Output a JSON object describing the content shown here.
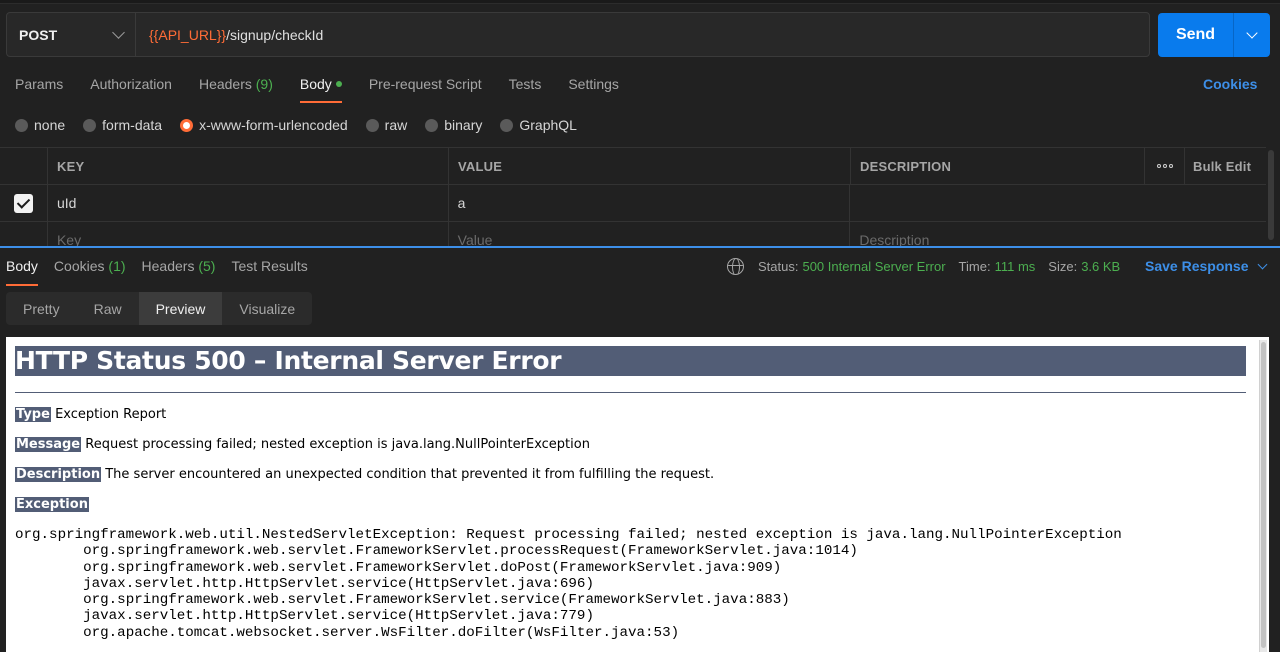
{
  "request": {
    "method": "POST",
    "url_variable": "{{API_URL}}",
    "url_path": "/signup/checkId",
    "send_label": "Send"
  },
  "request_tabs": [
    {
      "label": "Params",
      "count": ""
    },
    {
      "label": "Authorization",
      "count": ""
    },
    {
      "label": "Headers",
      "count": "(9)"
    },
    {
      "label": "Body",
      "count": ""
    },
    {
      "label": "Pre-request Script",
      "count": ""
    },
    {
      "label": "Tests",
      "count": ""
    },
    {
      "label": "Settings",
      "count": ""
    }
  ],
  "cookies_label": "Cookies",
  "body_types": [
    "none",
    "form-data",
    "x-www-form-urlencoded",
    "raw",
    "binary",
    "GraphQL"
  ],
  "params_table": {
    "headers": [
      "KEY",
      "VALUE",
      "DESCRIPTION"
    ],
    "bulk_edit": "Bulk Edit",
    "rows": [
      {
        "key": "uId",
        "value": "a",
        "description": ""
      }
    ],
    "placeholder": {
      "key": "Key",
      "value": "Value",
      "description": "Description"
    }
  },
  "response_tabs": [
    {
      "label": "Body",
      "count": ""
    },
    {
      "label": "Cookies",
      "count": "(1)"
    },
    {
      "label": "Headers",
      "count": "(5)"
    },
    {
      "label": "Test Results",
      "count": ""
    }
  ],
  "response_status": {
    "status_label": "Status:",
    "status_value": "500 Internal Server Error",
    "time_label": "Time:",
    "time_value": "111 ms",
    "size_label": "Size:",
    "size_value": "3.6 KB",
    "save_label": "Save Response"
  },
  "view_tabs": [
    "Pretty",
    "Raw",
    "Preview",
    "Visualize"
  ],
  "preview": {
    "title": "HTTP Status 500 – Internal Server Error",
    "type_label": "Type",
    "type_value": "Exception Report",
    "message_label": "Message",
    "message_value": "Request processing failed; nested exception is java.lang.NullPointerException",
    "description_label": "Description",
    "description_value": "The server encountered an unexpected condition that prevented it from fulfilling the request.",
    "exception_label": "Exception",
    "stack_trace": "org.springframework.web.util.NestedServletException: Request processing failed; nested exception is java.lang.NullPointerException\n\torg.springframework.web.servlet.FrameworkServlet.processRequest(FrameworkServlet.java:1014)\n\torg.springframework.web.servlet.FrameworkServlet.doPost(FrameworkServlet.java:909)\n\tjavax.servlet.http.HttpServlet.service(HttpServlet.java:696)\n\torg.springframework.web.servlet.FrameworkServlet.service(FrameworkServlet.java:883)\n\tjavax.servlet.http.HttpServlet.service(HttpServlet.java:779)\n\torg.apache.tomcat.websocket.server.WsFilter.doFilter(WsFilter.java:53)"
  },
  "colors": {
    "accent_orange": "#ff6c37",
    "send_blue": "#097bed",
    "link_blue": "#3d8fe8",
    "status_green": "#4caf50",
    "tomcat_header": "#525d76"
  }
}
